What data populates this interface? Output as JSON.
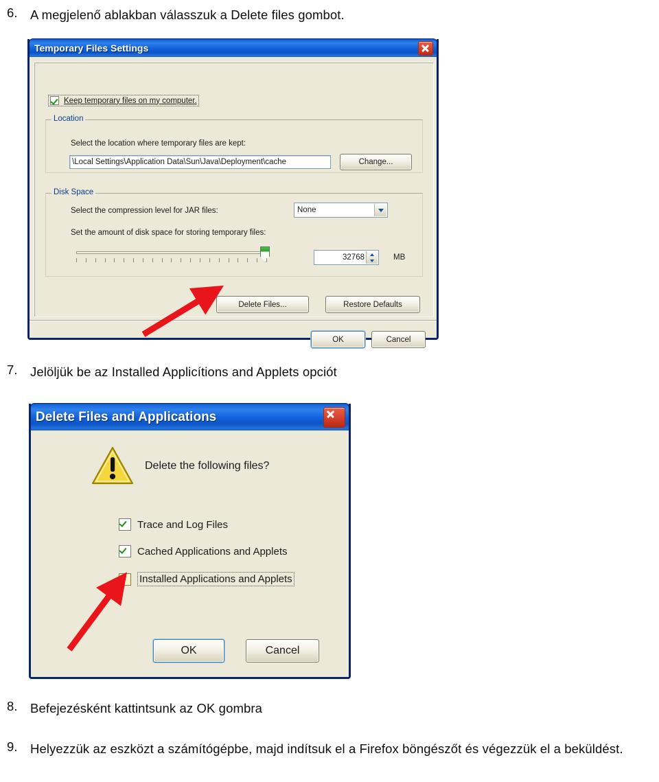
{
  "document": {
    "steps": [
      {
        "num": "6.",
        "text": "A megjelenő ablakban válasszuk a Delete files gombot."
      },
      {
        "num": "7.",
        "text": "Jelöljük be az Installed Applicítions and Applets opciót"
      },
      {
        "num": "8.",
        "text": "Befejezésként kattintsunk az OK gombra"
      },
      {
        "num": "9.",
        "text": "Helyezzük az eszközt a számítógépbe, majd indítsuk el a Firefox böngészőt és végezzük el a beküldést."
      }
    ]
  },
  "dialog1": {
    "title": "Temporary Files Settings",
    "close_icon": "close-icon",
    "keep_temp_checkbox": {
      "label": "Keep temporary files on my computer.",
      "checked": true
    },
    "location_group": {
      "legend": "Location",
      "description": "Select the location where temporary files are kept:",
      "path_value": "\\Local Settings\\Application Data\\Sun\\Java\\Deployment\\cache",
      "change_button": "Change..."
    },
    "disk_space_group": {
      "legend": "Disk Space",
      "compression_label": "Select the compression level for JAR files:",
      "compression_value": "None",
      "compression_options": [
        "None"
      ],
      "amount_label": "Set the amount of disk space for storing temporary files:",
      "amount_value": "32768",
      "amount_unit": "MB",
      "slider_position_percent": 100,
      "slider_tick_count": 21
    },
    "buttons": {
      "delete_files": "Delete Files...",
      "restore_defaults": "Restore Defaults",
      "ok": "OK",
      "cancel": "Cancel"
    }
  },
  "dialog2": {
    "title": "Delete Files and Applications",
    "close_icon": "close-icon",
    "warning_icon": "warning-triangle-icon",
    "prompt": "Delete the following files?",
    "checkboxes": [
      {
        "label": "Trace and Log Files",
        "checked": true,
        "focused": false
      },
      {
        "label": "Cached Applications and Applets",
        "checked": true,
        "focused": false
      },
      {
        "label": "Installed Applications and Applets",
        "checked": true,
        "focused": true
      }
    ],
    "buttons": {
      "ok": "OK",
      "cancel": "Cancel"
    }
  },
  "annotations": {
    "arrow_color": "#e8161a",
    "arrow1_target": "delete-files-button",
    "arrow2_target": "installed-applications-checkbox"
  },
  "colors": {
    "titlebar_blue": "#1364dd",
    "window_border": "#0a246a",
    "dialog_face": "#ece9d8",
    "group_legend": "#0a3d8f",
    "check_green": "#169416",
    "close_red": "#d9452f",
    "arrow_red": "#e8161a",
    "warning_yellow": "#f5d547"
  }
}
